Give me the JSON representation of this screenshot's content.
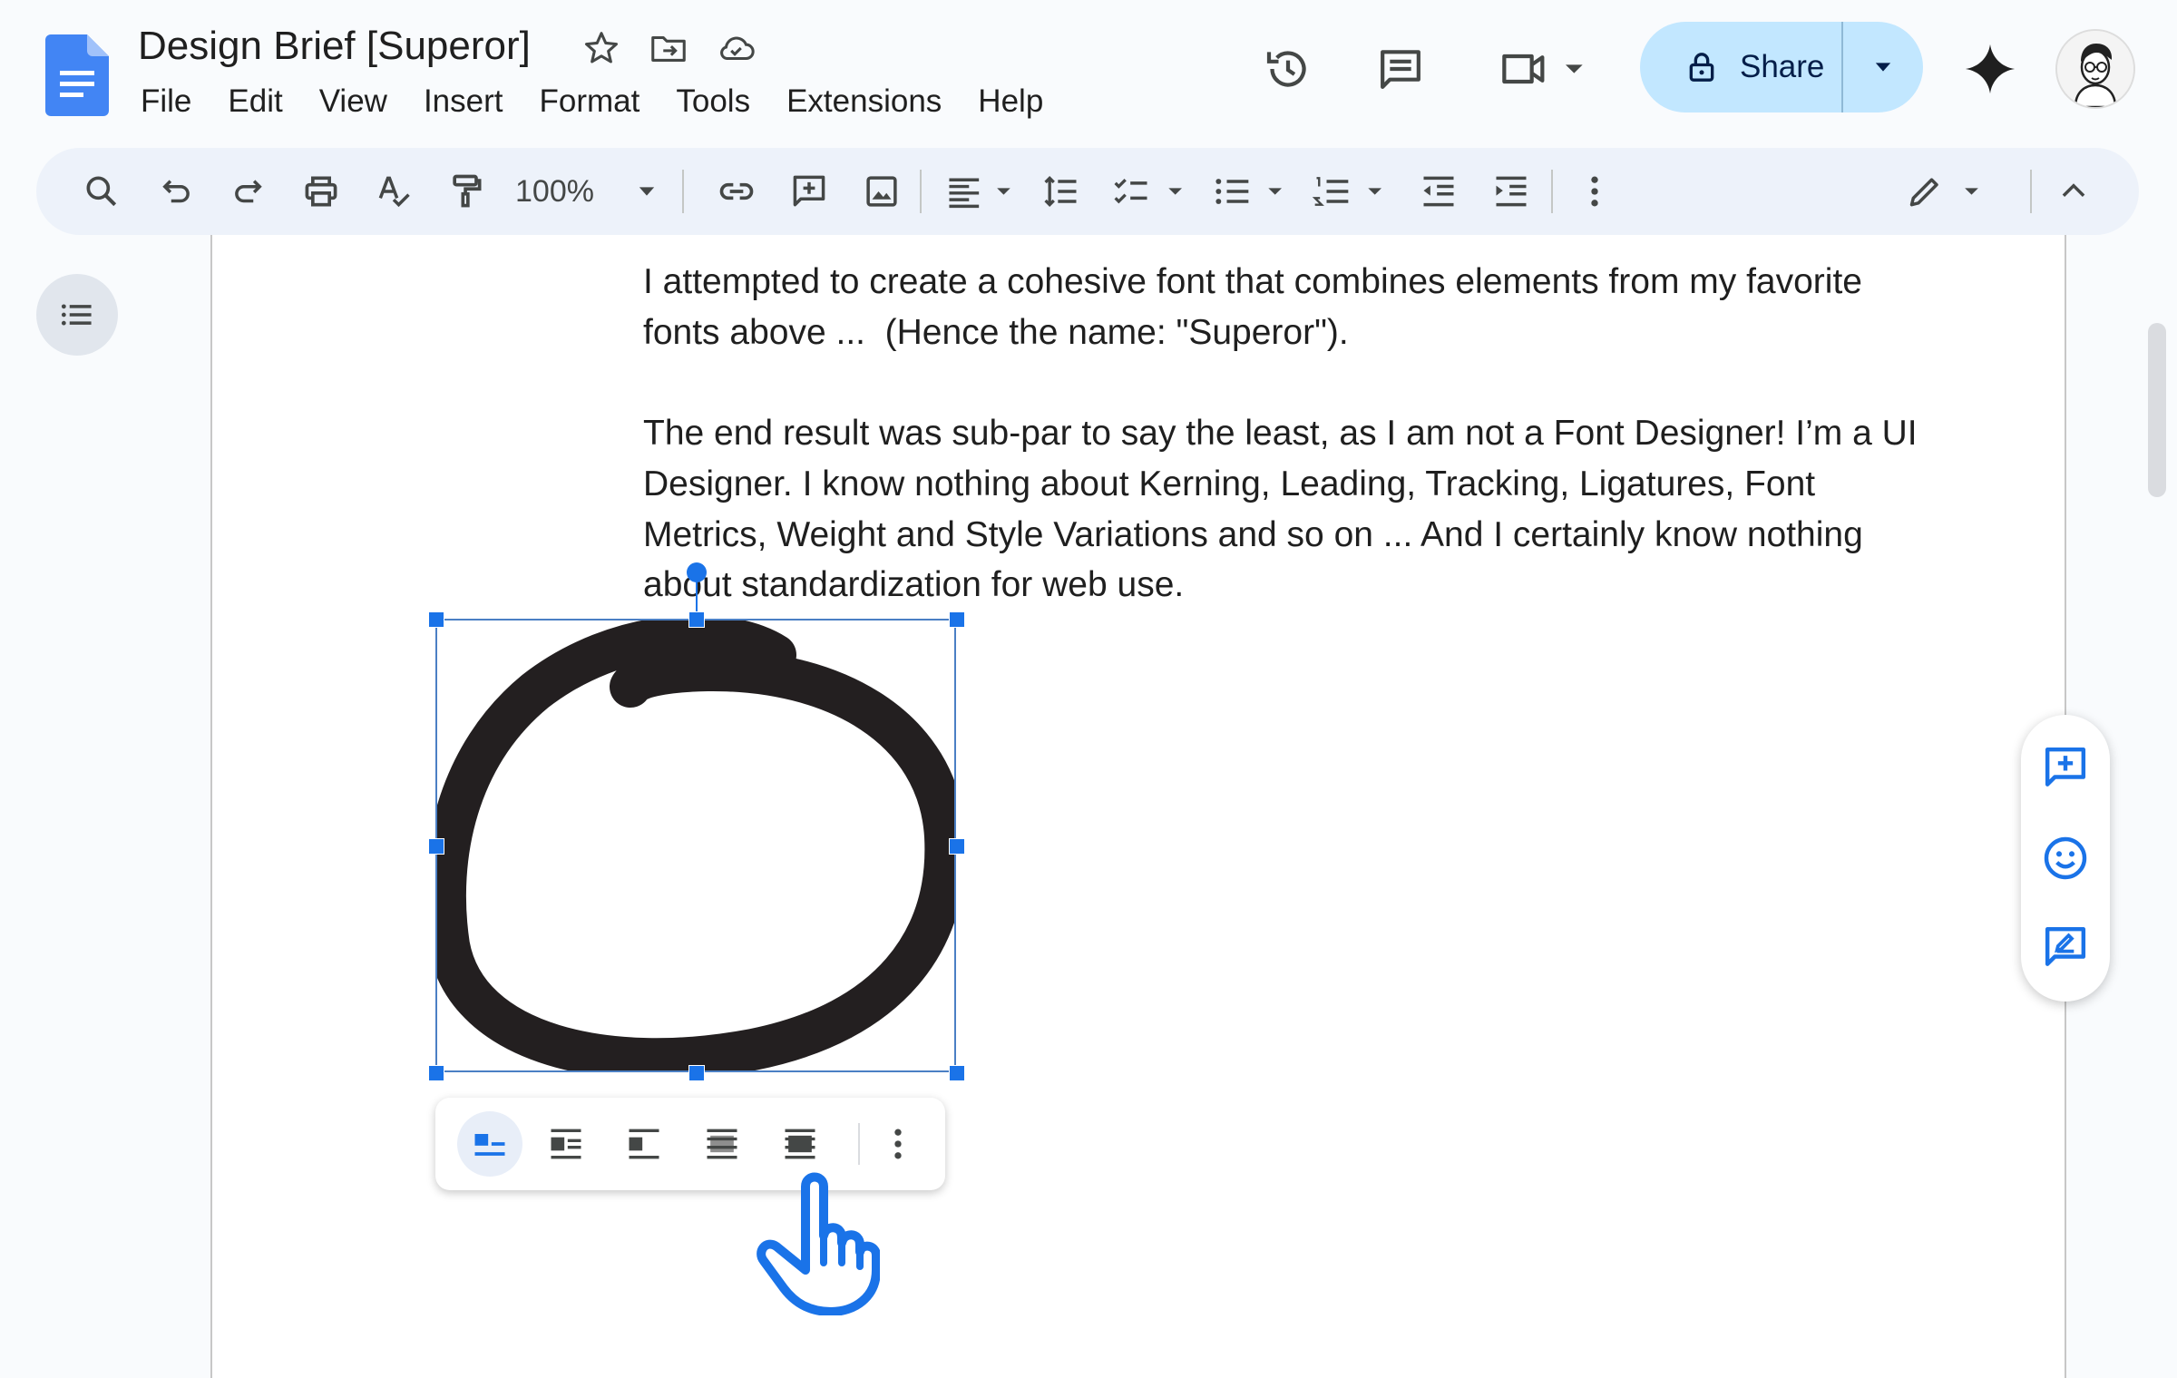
{
  "document": {
    "title": "Design Brief [Superor]"
  },
  "menu": [
    "File",
    "Edit",
    "View",
    "Insert",
    "Format",
    "Tools",
    "Extensions",
    "Help"
  ],
  "header": {
    "share_label": "Share"
  },
  "toolbar": {
    "zoom": "100%"
  },
  "body": {
    "paragraph1_line1": "I attempted to create a cohesive font that combines elements from my favorite",
    "paragraph1_line2": "fonts above ...  (Hence the name: \"Superor\").",
    "paragraph2_line1": "The end result was sub-par to say the least, as I am not a Font Designer! I’m a UI",
    "paragraph2_line2": "Designer. I know nothing about Kerning, Leading, Tracking, Ligatures, Font",
    "paragraph2_line3": "Metrics, Weight and Style Variations and so on ... And I certainly know nothing",
    "paragraph2_line4": "about standardization for web use."
  },
  "colors": {
    "accent": "#1a73e8",
    "share_bg": "#c2e7ff",
    "toolbar_bg": "#edf2fa",
    "page_bg": "#ffffff",
    "app_bg": "#f9fbfd"
  },
  "icons": {
    "title_row": [
      "star-icon",
      "move-to-folder-icon",
      "cloud-saved-icon"
    ],
    "header_right": [
      "version-history-icon",
      "comments-icon",
      "meet-icon",
      "lock-icon",
      "gemini-icon"
    ],
    "image_wrap_options": [
      "inline-wrap-icon",
      "wrap-text-icon",
      "break-text-icon",
      "behind-text-icon",
      "in-front-of-text-icon",
      "more-options-icon"
    ],
    "side_panel": [
      "add-comment-icon",
      "emoji-reaction-icon",
      "suggest-edits-icon"
    ]
  }
}
